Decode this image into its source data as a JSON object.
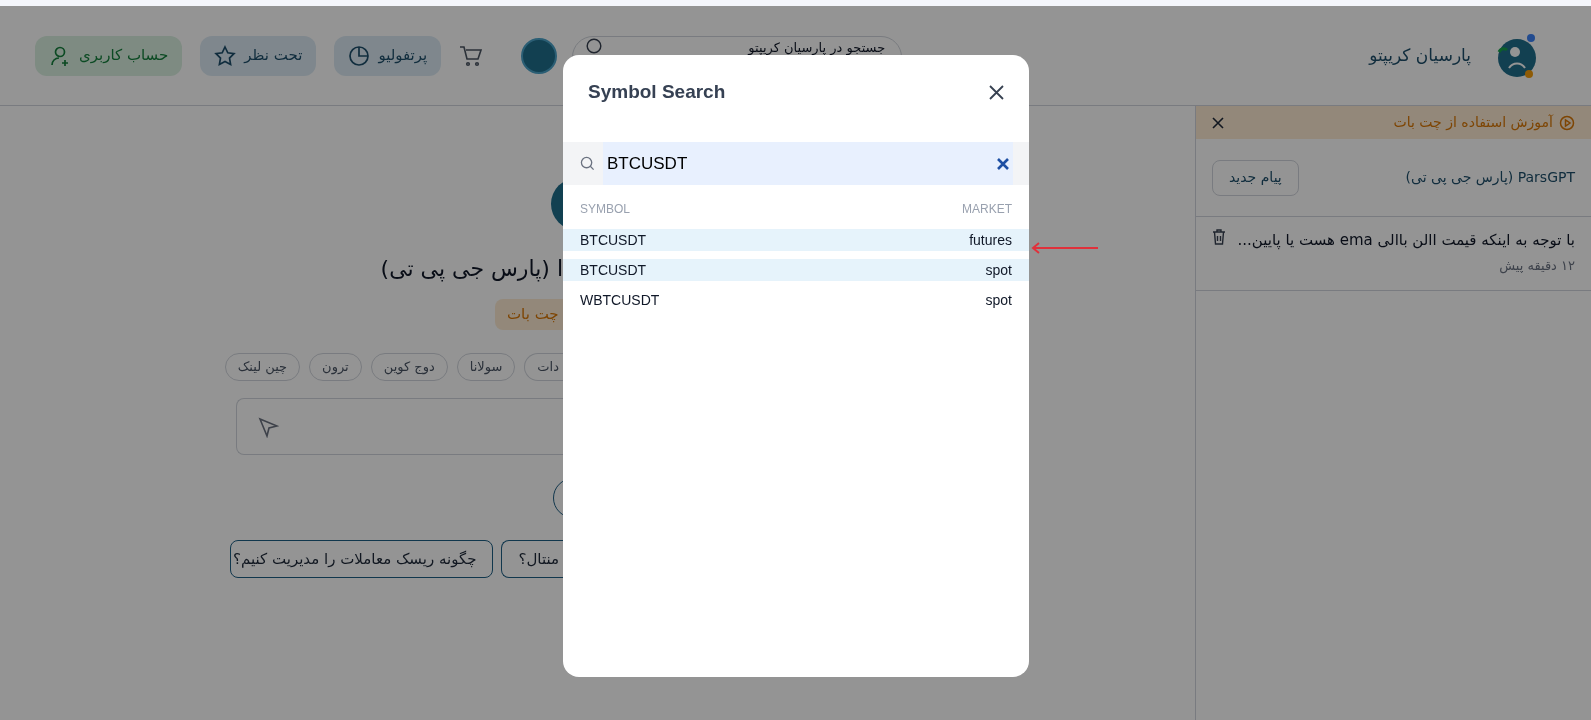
{
  "header": {
    "brand": "پارسیان کریپتو",
    "search": {
      "placeholder": "جستجو در پارسیان کریپتو"
    },
    "nav": [
      {
        "label": "پرتفولیو",
        "kind": "portfolio"
      },
      {
        "label": "تحت نظر",
        "kind": "watchlist"
      },
      {
        "label": "حساب کاربری",
        "kind": "account"
      }
    ]
  },
  "chat": {
    "title": "ا (پارس جی پی تی)",
    "badge": "چت بات",
    "chips": [
      "دات",
      "سولانا",
      "دوج کوین",
      "ترون",
      "چین لینک"
    ],
    "suggestions": [
      "منتال؟",
      "چگونه ریسک معاملات را مدیریت کنیم؟"
    ]
  },
  "sidebar": {
    "tutorial": "آموزش استفاده از چت بات",
    "title": "ParsGPT (پارس جی پی تی)",
    "new_button": "پیام جدید",
    "history": [
      {
        "text": "با توجه به اینکه قیمت االن باالی ema هست یا پایین...",
        "time": "۱۲ دقیقه پیش"
      }
    ]
  },
  "modal": {
    "title": "Symbol Search",
    "search_value": "BTCUSDT",
    "symbol_header": "SYMBOL",
    "market_header": "MARKET",
    "rows": [
      {
        "symbol": "BTCUSDT",
        "market": "futures",
        "highlighted": true
      },
      {
        "symbol": "BTCUSDT",
        "market": "spot",
        "highlighted": true
      },
      {
        "symbol": "WBTCUSDT",
        "market": "spot",
        "highlighted": false
      }
    ]
  }
}
